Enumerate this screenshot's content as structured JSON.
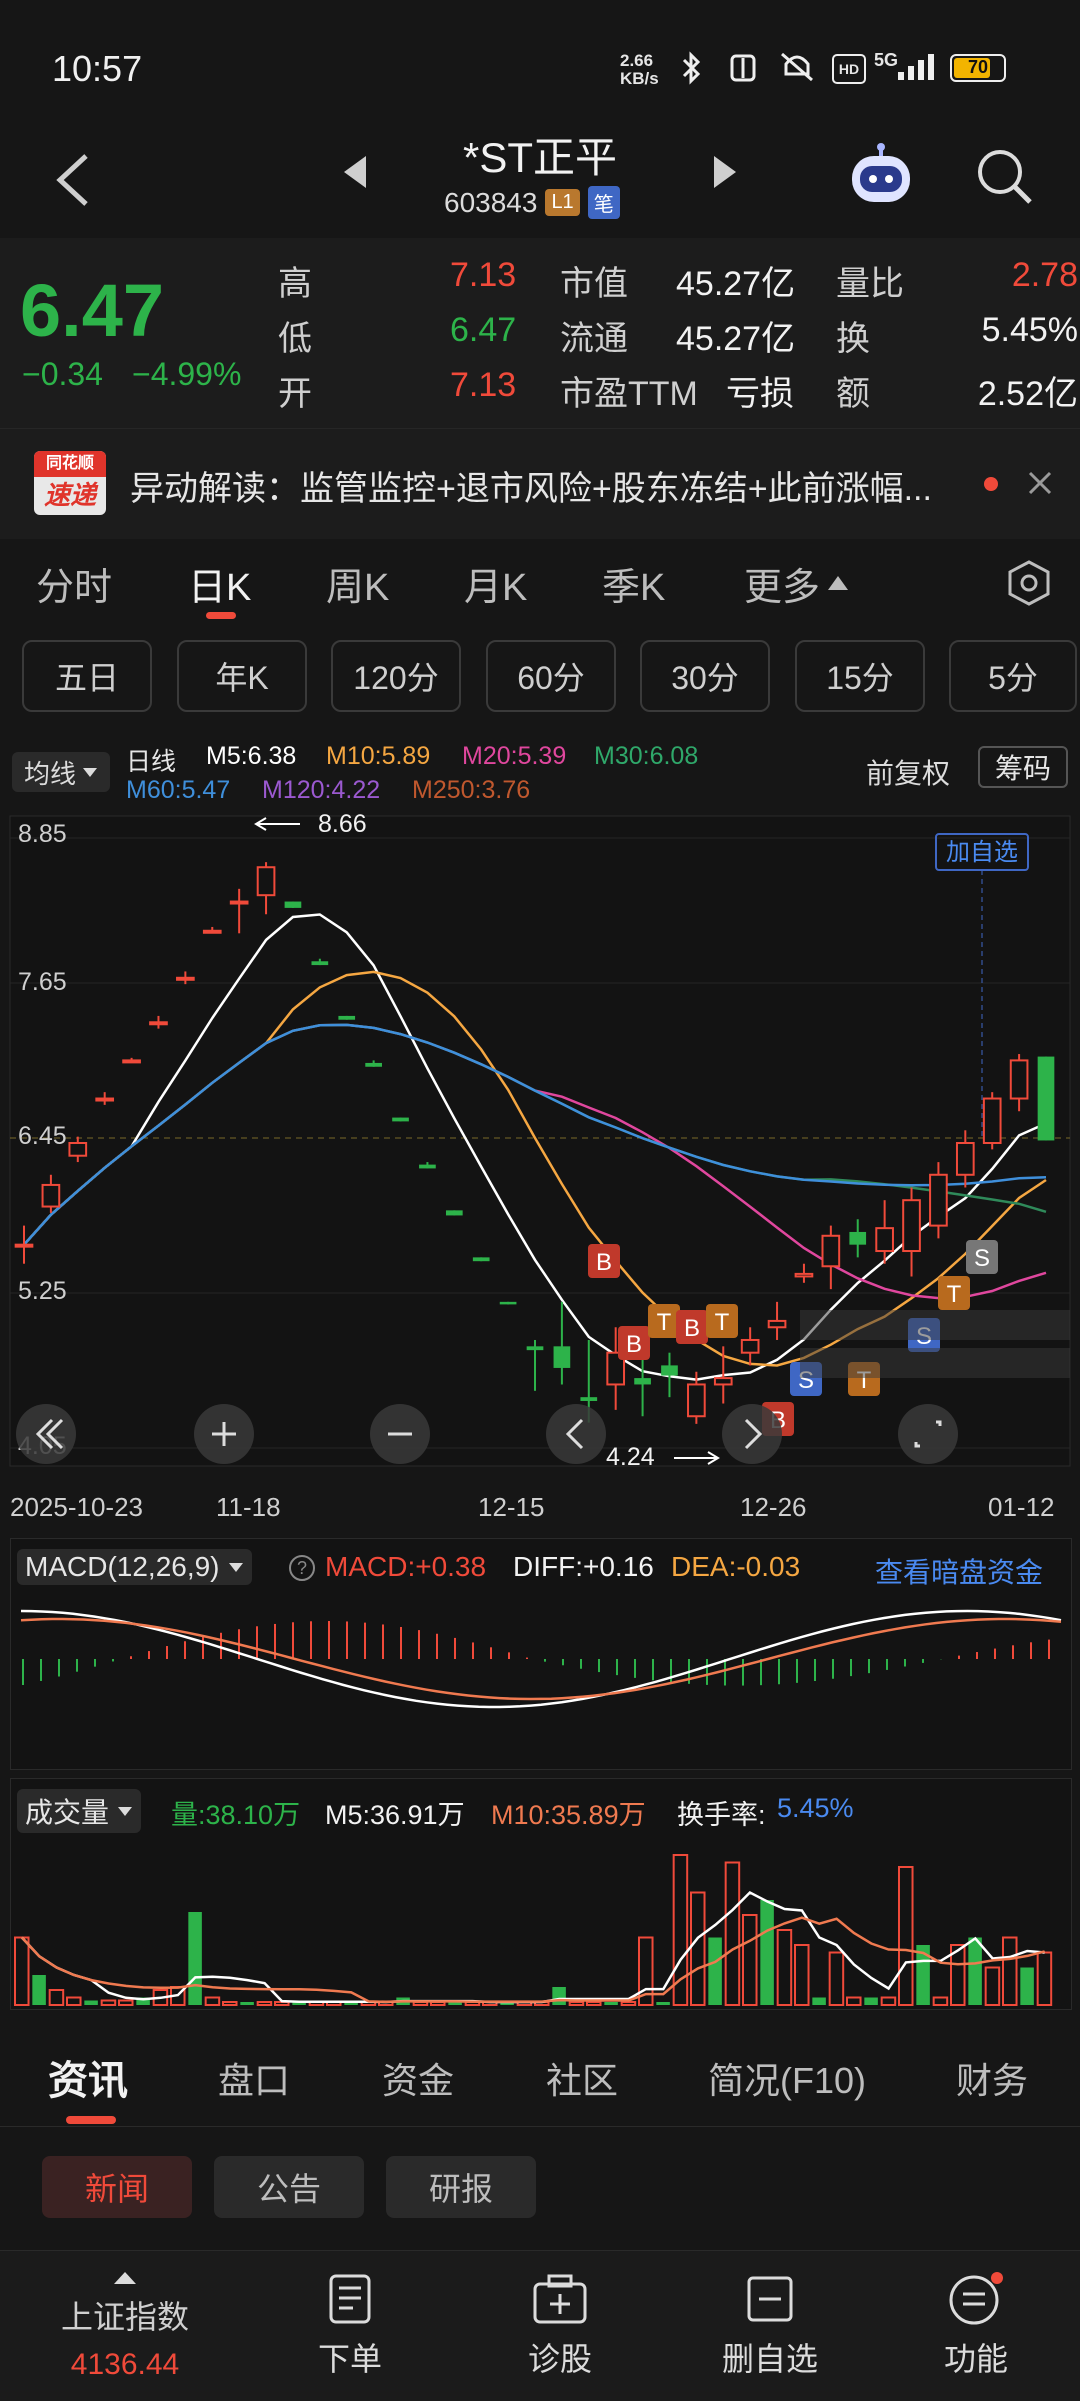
{
  "status_bar": {
    "time": "10:57",
    "net_speed": "2.66\nKB/s",
    "battery": "70",
    "signal": "5G"
  },
  "header": {
    "title": "*ST正平",
    "code": "603843",
    "badge1": "L1",
    "badge2": "笔"
  },
  "quote": {
    "price": "6.47",
    "change": "−0.34",
    "pct": "−4.99%",
    "rows": [
      {
        "l1": "高",
        "v1": "7.13",
        "l2": "市值",
        "v2": "45.27亿",
        "l3": "量比",
        "v3": "2.78"
      },
      {
        "l1": "低",
        "v1": "6.47",
        "l2": "流通",
        "v2": "45.27亿",
        "l3": "换",
        "v3": "5.45%"
      },
      {
        "l1": "开",
        "v1": "7.13",
        "l2": "市盈TTM",
        "v2": "亏损",
        "l3": "额",
        "v3": "2.52亿"
      }
    ]
  },
  "alert": {
    "logo_line1": "同花顺",
    "logo_line2": "速递",
    "text": "异动解读：监管监控+退市风险+股东冻结+此前涨幅..."
  },
  "period_tabs": [
    "分时",
    "日K",
    "周K",
    "月K",
    "季K",
    "更多"
  ],
  "interval_pills": [
    "五日",
    "年K",
    "120分",
    "60分",
    "30分",
    "15分",
    "5分"
  ],
  "ma_legend": {
    "selector": "均线",
    "line1": "日线",
    "m5": "M5:6.38",
    "m10": "M10:5.89",
    "m20": "M20:5.39",
    "m30": "M30:6.08",
    "m60": "M60:5.47",
    "m120": "M120:4.22",
    "m250": "M250:3.76",
    "fq": "前复权",
    "chip": "筹码"
  },
  "kline": {
    "y_ticks": [
      "8.85",
      "7.65",
      "6.45",
      "5.25",
      "4.05"
    ],
    "x_ticks": [
      "2025-10-23",
      "11-18",
      "12-15",
      "12-26",
      "01-12"
    ],
    "high_label": "8.66",
    "low_label": "4.24",
    "add_watch": "加自选",
    "colors": {
      "up": "#f04a3a",
      "down": "#2db34a",
      "m5": "#ffffff",
      "m10": "#f5a742",
      "m20": "#e0479e",
      "m30": "#2f8a5a",
      "m60": "#3f8fdb"
    }
  },
  "macd": {
    "name": "MACD(12,26,9)",
    "macd": "MACD:+0.38",
    "diff": "DIFF:+0.16",
    "dea": "DEA:-0.03",
    "link": "查看暗盘资金"
  },
  "volume": {
    "name": "成交量",
    "vol": "量:38.10万",
    "m5": "M5:36.91万",
    "m10": "M10:35.89万",
    "turnover_label": "换手率:",
    "turnover": "5.45%"
  },
  "info_tabs": [
    "资讯",
    "盘口",
    "资金",
    "社区",
    "简况(F10)",
    "财务"
  ],
  "sub_tabs": [
    "新闻",
    "公告",
    "研报"
  ],
  "bottom_nav": {
    "index_name": "上证指数",
    "index_value": "4136.44",
    "items": [
      "下单",
      "诊股",
      "删自选",
      "功能"
    ]
  },
  "chart_data": {
    "type": "candlestick",
    "title": "",
    "ylim": [
      4.05,
      8.85
    ],
    "x_ticks": [
      "2025-10-23",
      "11-18",
      "12-15",
      "12-26",
      "01-12"
    ],
    "annotations": {
      "high": 8.66,
      "low": 4.24
    },
    "candles": [
      {
        "o": 5.65,
        "c": 5.65,
        "h": 5.8,
        "l": 5.5
      },
      {
        "o": 5.95,
        "c": 6.12,
        "h": 6.2,
        "l": 5.9
      },
      {
        "o": 6.35,
        "c": 6.45,
        "h": 6.5,
        "l": 6.3
      },
      {
        "o": 6.8,
        "c": 6.8,
        "h": 6.85,
        "l": 6.75
      },
      {
        "o": 7.1,
        "c": 7.1,
        "h": 7.12,
        "l": 7.08
      },
      {
        "o": 7.4,
        "c": 7.4,
        "h": 7.45,
        "l": 7.35
      },
      {
        "o": 7.75,
        "c": 7.75,
        "h": 7.8,
        "l": 7.7
      },
      {
        "o": 8.12,
        "c": 8.12,
        "h": 8.15,
        "l": 8.1
      },
      {
        "o": 8.35,
        "c": 8.35,
        "h": 8.45,
        "l": 8.1
      },
      {
        "o": 8.4,
        "c": 8.62,
        "h": 8.66,
        "l": 8.25
      },
      {
        "o": 8.35,
        "c": 8.3,
        "h": 8.35,
        "l": 8.3
      },
      {
        "o": 7.88,
        "c": 7.85,
        "h": 7.9,
        "l": 7.85
      },
      {
        "o": 7.45,
        "c": 7.42,
        "h": 7.45,
        "l": 7.42
      },
      {
        "o": 7.08,
        "c": 7.05,
        "h": 7.1,
        "l": 7.05
      },
      {
        "o": 6.65,
        "c": 6.62,
        "h": 6.65,
        "l": 6.62
      },
      {
        "o": 6.28,
        "c": 6.25,
        "h": 6.3,
        "l": 6.25
      },
      {
        "o": 5.92,
        "c": 5.88,
        "h": 5.92,
        "l": 5.88
      },
      {
        "o": 5.55,
        "c": 5.52,
        "h": 5.55,
        "l": 5.52
      },
      {
        "o": 5.2,
        "c": 5.18,
        "h": 5.2,
        "l": 5.18
      },
      {
        "o": 4.85,
        "c": 4.82,
        "h": 4.9,
        "l": 4.5
      },
      {
        "o": 4.85,
        "c": 4.68,
        "h": 5.2,
        "l": 4.55
      },
      {
        "o": 4.45,
        "c": 4.42,
        "h": 4.9,
        "l": 4.25
      },
      {
        "o": 4.55,
        "c": 4.8,
        "h": 5.0,
        "l": 4.35
      },
      {
        "o": 4.6,
        "c": 4.55,
        "h": 4.9,
        "l": 4.3
      },
      {
        "o": 4.7,
        "c": 4.62,
        "h": 4.8,
        "l": 4.45
      },
      {
        "o": 4.3,
        "c": 4.55,
        "h": 4.65,
        "l": 4.24
      },
      {
        "o": 4.55,
        "c": 4.6,
        "h": 4.85,
        "l": 4.4
      },
      {
        "o": 4.8,
        "c": 4.9,
        "h": 5.0,
        "l": 4.7
      },
      {
        "o": 5.0,
        "c": 5.05,
        "h": 5.2,
        "l": 4.9
      },
      {
        "o": 5.4,
        "c": 5.42,
        "h": 5.5,
        "l": 5.35
      },
      {
        "o": 5.48,
        "c": 5.72,
        "h": 5.8,
        "l": 5.3
      },
      {
        "o": 5.75,
        "c": 5.65,
        "h": 5.85,
        "l": 5.55
      },
      {
        "o": 5.6,
        "c": 5.78,
        "h": 6.0,
        "l": 5.5
      },
      {
        "o": 5.6,
        "c": 6.0,
        "h": 6.1,
        "l": 5.4
      },
      {
        "o": 5.8,
        "c": 6.2,
        "h": 6.3,
        "l": 5.7
      },
      {
        "o": 6.2,
        "c": 6.45,
        "h": 6.55,
        "l": 6.1
      },
      {
        "o": 6.45,
        "c": 6.8,
        "h": 6.85,
        "l": 6.4
      },
      {
        "o": 6.8,
        "c": 7.1,
        "h": 7.15,
        "l": 6.7
      },
      {
        "o": 7.13,
        "c": 6.47,
        "h": 7.13,
        "l": 6.47
      }
    ]
  }
}
